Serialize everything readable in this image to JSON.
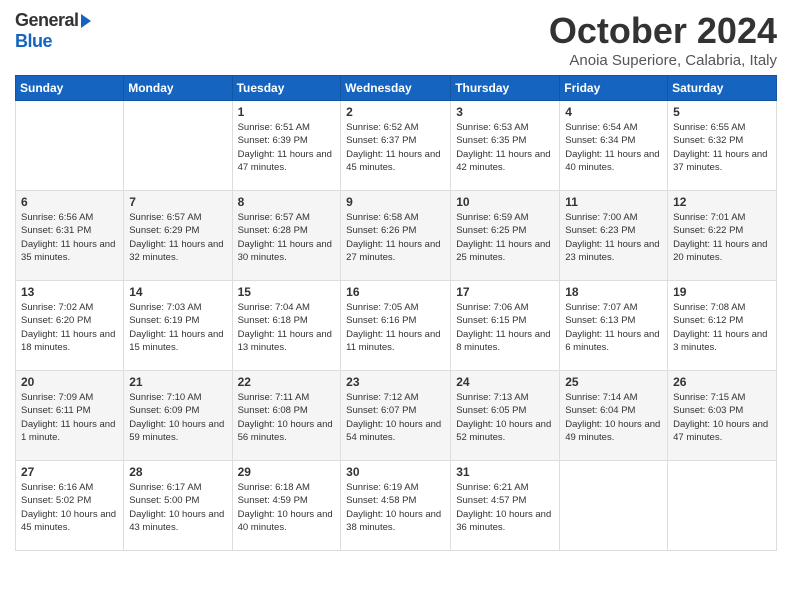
{
  "header": {
    "logo_general": "General",
    "logo_blue": "Blue",
    "month": "October 2024",
    "location": "Anoia Superiore, Calabria, Italy"
  },
  "days_of_week": [
    "Sunday",
    "Monday",
    "Tuesday",
    "Wednesday",
    "Thursday",
    "Friday",
    "Saturday"
  ],
  "weeks": [
    [
      {
        "day": "",
        "info": ""
      },
      {
        "day": "",
        "info": ""
      },
      {
        "day": "1",
        "info": "Sunrise: 6:51 AM\nSunset: 6:39 PM\nDaylight: 11 hours and 47 minutes."
      },
      {
        "day": "2",
        "info": "Sunrise: 6:52 AM\nSunset: 6:37 PM\nDaylight: 11 hours and 45 minutes."
      },
      {
        "day": "3",
        "info": "Sunrise: 6:53 AM\nSunset: 6:35 PM\nDaylight: 11 hours and 42 minutes."
      },
      {
        "day": "4",
        "info": "Sunrise: 6:54 AM\nSunset: 6:34 PM\nDaylight: 11 hours and 40 minutes."
      },
      {
        "day": "5",
        "info": "Sunrise: 6:55 AM\nSunset: 6:32 PM\nDaylight: 11 hours and 37 minutes."
      }
    ],
    [
      {
        "day": "6",
        "info": "Sunrise: 6:56 AM\nSunset: 6:31 PM\nDaylight: 11 hours and 35 minutes."
      },
      {
        "day": "7",
        "info": "Sunrise: 6:57 AM\nSunset: 6:29 PM\nDaylight: 11 hours and 32 minutes."
      },
      {
        "day": "8",
        "info": "Sunrise: 6:57 AM\nSunset: 6:28 PM\nDaylight: 11 hours and 30 minutes."
      },
      {
        "day": "9",
        "info": "Sunrise: 6:58 AM\nSunset: 6:26 PM\nDaylight: 11 hours and 27 minutes."
      },
      {
        "day": "10",
        "info": "Sunrise: 6:59 AM\nSunset: 6:25 PM\nDaylight: 11 hours and 25 minutes."
      },
      {
        "day": "11",
        "info": "Sunrise: 7:00 AM\nSunset: 6:23 PM\nDaylight: 11 hours and 23 minutes."
      },
      {
        "day": "12",
        "info": "Sunrise: 7:01 AM\nSunset: 6:22 PM\nDaylight: 11 hours and 20 minutes."
      }
    ],
    [
      {
        "day": "13",
        "info": "Sunrise: 7:02 AM\nSunset: 6:20 PM\nDaylight: 11 hours and 18 minutes."
      },
      {
        "day": "14",
        "info": "Sunrise: 7:03 AM\nSunset: 6:19 PM\nDaylight: 11 hours and 15 minutes."
      },
      {
        "day": "15",
        "info": "Sunrise: 7:04 AM\nSunset: 6:18 PM\nDaylight: 11 hours and 13 minutes."
      },
      {
        "day": "16",
        "info": "Sunrise: 7:05 AM\nSunset: 6:16 PM\nDaylight: 11 hours and 11 minutes."
      },
      {
        "day": "17",
        "info": "Sunrise: 7:06 AM\nSunset: 6:15 PM\nDaylight: 11 hours and 8 minutes."
      },
      {
        "day": "18",
        "info": "Sunrise: 7:07 AM\nSunset: 6:13 PM\nDaylight: 11 hours and 6 minutes."
      },
      {
        "day": "19",
        "info": "Sunrise: 7:08 AM\nSunset: 6:12 PM\nDaylight: 11 hours and 3 minutes."
      }
    ],
    [
      {
        "day": "20",
        "info": "Sunrise: 7:09 AM\nSunset: 6:11 PM\nDaylight: 11 hours and 1 minute."
      },
      {
        "day": "21",
        "info": "Sunrise: 7:10 AM\nSunset: 6:09 PM\nDaylight: 10 hours and 59 minutes."
      },
      {
        "day": "22",
        "info": "Sunrise: 7:11 AM\nSunset: 6:08 PM\nDaylight: 10 hours and 56 minutes."
      },
      {
        "day": "23",
        "info": "Sunrise: 7:12 AM\nSunset: 6:07 PM\nDaylight: 10 hours and 54 minutes."
      },
      {
        "day": "24",
        "info": "Sunrise: 7:13 AM\nSunset: 6:05 PM\nDaylight: 10 hours and 52 minutes."
      },
      {
        "day": "25",
        "info": "Sunrise: 7:14 AM\nSunset: 6:04 PM\nDaylight: 10 hours and 49 minutes."
      },
      {
        "day": "26",
        "info": "Sunrise: 7:15 AM\nSunset: 6:03 PM\nDaylight: 10 hours and 47 minutes."
      }
    ],
    [
      {
        "day": "27",
        "info": "Sunrise: 6:16 AM\nSunset: 5:02 PM\nDaylight: 10 hours and 45 minutes."
      },
      {
        "day": "28",
        "info": "Sunrise: 6:17 AM\nSunset: 5:00 PM\nDaylight: 10 hours and 43 minutes."
      },
      {
        "day": "29",
        "info": "Sunrise: 6:18 AM\nSunset: 4:59 PM\nDaylight: 10 hours and 40 minutes."
      },
      {
        "day": "30",
        "info": "Sunrise: 6:19 AM\nSunset: 4:58 PM\nDaylight: 10 hours and 38 minutes."
      },
      {
        "day": "31",
        "info": "Sunrise: 6:21 AM\nSunset: 4:57 PM\nDaylight: 10 hours and 36 minutes."
      },
      {
        "day": "",
        "info": ""
      },
      {
        "day": "",
        "info": ""
      }
    ]
  ]
}
